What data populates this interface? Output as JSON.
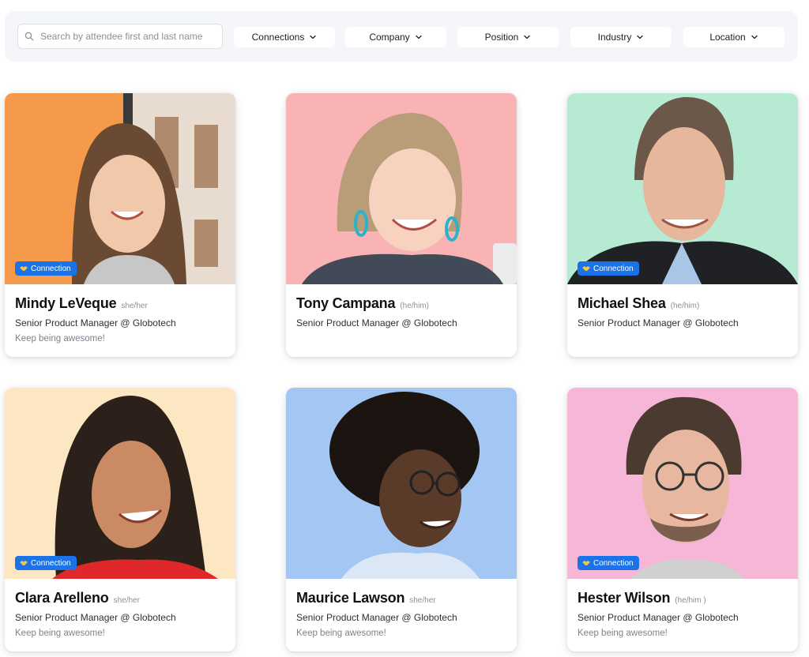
{
  "filters": {
    "search_placeholder": "Search by attendee first and last name",
    "dropdowns": [
      "Connections",
      "Company",
      "Position",
      "Industry",
      "Location"
    ]
  },
  "colors": {
    "badge": "#1a73e8",
    "card_backgrounds": [
      "#f59a4a",
      "#f9b3b5",
      "#b7ead2",
      "#fde6c2",
      "#a3c6f2",
      "#f6b6d8"
    ]
  },
  "attendees": [
    {
      "name": "Mindy LeVeque",
      "pronouns": "she/her",
      "title": "Senior Product Manager @ Globotech",
      "tagline": "Keep being awesome!",
      "badge": "Connection"
    },
    {
      "name": "Tony Campana",
      "pronouns": "(he/him)",
      "title": "Senior Product Manager @ Globotech",
      "tagline": "",
      "badge": ""
    },
    {
      "name": "Michael Shea",
      "pronouns": "(he/him)",
      "title": "Senior Product Manager @ Globotech",
      "tagline": "",
      "badge": "Connection"
    },
    {
      "name": "Clara Arelleno",
      "pronouns": "she/her",
      "title": "Senior Product Manager @ Globotech",
      "tagline": "Keep being awesome!",
      "badge": "Connection"
    },
    {
      "name": "Maurice Lawson",
      "pronouns": "she/her",
      "title": "Senior Product Manager @ Globotech",
      "tagline": "Keep being awesome!",
      "badge": ""
    },
    {
      "name": "Hester Wilson",
      "pronouns": "(he/him )",
      "title": "Senior Product Manager @ Globotech",
      "tagline": "Keep being awesome!",
      "badge": "Connection"
    }
  ]
}
